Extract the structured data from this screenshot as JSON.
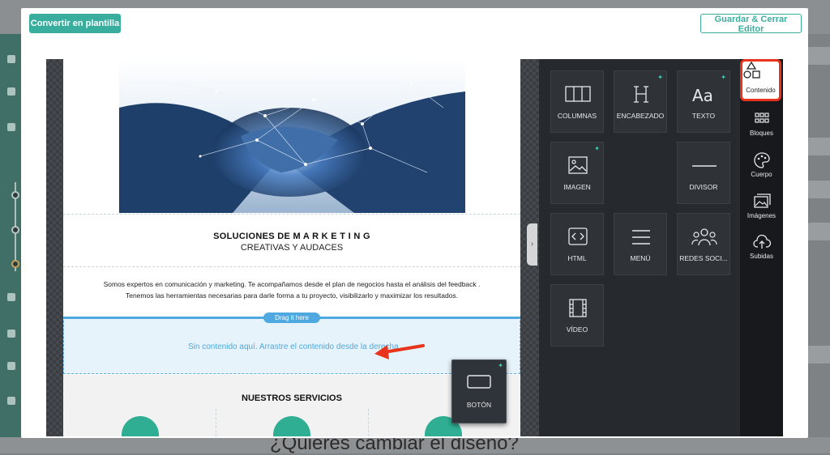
{
  "header": {
    "convert_label": "Convertir en plantilla",
    "save_close_label": "Guardar & Cerrar Editor"
  },
  "email": {
    "title_line1": "SOLUCIONES DE M A R K E T I N G",
    "title_line2": "CREATIVAS Y AUDACES",
    "body_line1": "Somos expertos en comunicación y marketing. Te acompañamos desde el plan de negocios hasta el análisis del feedback .",
    "body_line2": "Tenemos las herramientas necesarias para darle forma a tu proyecto, visibilizarlo y maximizar los resultados.",
    "drag_hint": "Drag it here",
    "drop_placeholder": "Sin contenido aquí. Arrastre el contenido desde la derecha",
    "services_title": "NUESTROS SERVICIOS"
  },
  "dragging_tile": {
    "label": "BOTÓN",
    "icon": "button-icon"
  },
  "tools": [
    {
      "label": "COLUMNAS",
      "icon": "columns-icon",
      "new": false
    },
    {
      "label": "ENCABEZADO",
      "icon": "heading-icon",
      "new": true
    },
    {
      "label": "TEXTO",
      "icon": "text-icon",
      "new": true
    },
    {
      "label": "IMAGEN",
      "icon": "image-icon",
      "new": true
    },
    {
      "label": "DIVISOR",
      "icon": "divider-icon",
      "new": false
    },
    {
      "label": "HTML",
      "icon": "html-icon",
      "new": false
    },
    {
      "label": "MENÚ",
      "icon": "menu-icon",
      "new": false
    },
    {
      "label": "REDES SOCI...",
      "icon": "social-icon",
      "new": false
    },
    {
      "label": "VÍDEO",
      "icon": "video-icon",
      "new": false
    }
  ],
  "rail": [
    {
      "label": "Contenido",
      "icon": "shapes-icon",
      "active": true
    },
    {
      "label": "Bloques",
      "icon": "blocks-icon",
      "active": false
    },
    {
      "label": "Cuerpo",
      "icon": "palette-icon",
      "active": false
    },
    {
      "label": "Imágenes",
      "icon": "images-icon",
      "active": false
    },
    {
      "label": "Subidas",
      "icon": "cloud-upload-icon",
      "active": false
    }
  ],
  "background": {
    "heading": "¿Quieres cambiar el diseño?"
  },
  "colors": {
    "accent": "#3aae9e",
    "drop_blue": "#4fa8e0",
    "highlight_red": "#e8341c",
    "panel_dark": "#26292d"
  }
}
